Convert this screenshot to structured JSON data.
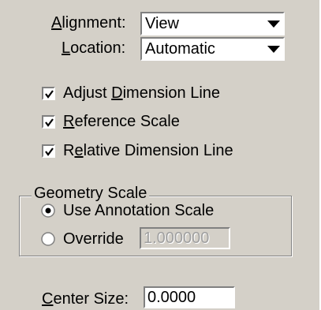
{
  "alignment": {
    "label_mnemonic": "A",
    "label_rest": "lignment:",
    "value": "View",
    "arrow_icon": "dropdown-arrow-icon"
  },
  "location": {
    "label_mnemonic": "L",
    "label_rest": "ocation:",
    "value": "Automatic",
    "arrow_icon": "dropdown-arrow-icon"
  },
  "checkboxes": [
    {
      "pre": "Adjust ",
      "mnemonic": "D",
      "post": "imension Line",
      "checked": true
    },
    {
      "pre": "",
      "mnemonic": "R",
      "post": "eference Scale",
      "checked": true
    },
    {
      "pre": "R",
      "mnemonic": "e",
      "post": "lative Dimension Line",
      "checked": true
    }
  ],
  "geometry_scale": {
    "title": "Geometry Scale",
    "use_annotation_label": "Use Annotation Scale",
    "use_annotation_selected": true,
    "override_label": "Override",
    "override_selected": false,
    "override_value": "1.000000"
  },
  "center_size": {
    "label_mnemonic": "C",
    "label_rest": "enter Size:",
    "value": "0.0000"
  }
}
